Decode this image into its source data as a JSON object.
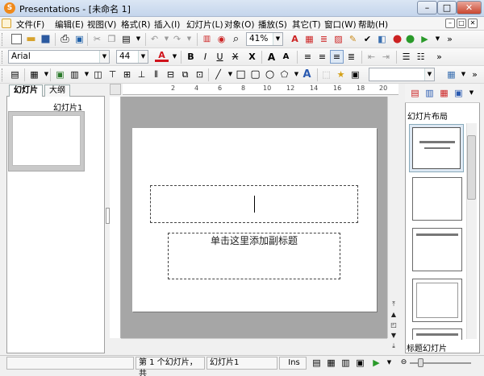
{
  "window": {
    "title": "Presentations - [未命名 1]",
    "app_icon_letter": "S",
    "buttons": [
      "–",
      "□",
      "✕"
    ]
  },
  "menubar": {
    "items": [
      "文件(F)",
      "编辑(E)",
      "视图(V)",
      "格式(R)",
      "插入(I)",
      "幻灯片(L)",
      "对象(O)",
      "播放(S)",
      "其它(T)",
      "窗口(W)",
      "帮助(H)"
    ],
    "doc_controls": [
      "–",
      "□",
      "✕"
    ]
  },
  "toolbar1": {
    "zoom": "41%",
    "overflow": "»"
  },
  "toolbar2": {
    "font_name": "Arial",
    "font_size": "44",
    "font_color_letter": "A",
    "bold": "B",
    "italic": "I",
    "underline": "U",
    "strike": "X",
    "shadow": "X",
    "grow": "A",
    "shrink": "A",
    "overflow": "»"
  },
  "toolbar3": {
    "text_letter": "A",
    "overflow": "»"
  },
  "left_panel": {
    "tabs": [
      "幻灯片",
      "大纲"
    ],
    "slide_label": "幻灯片1"
  },
  "ruler": {
    "ticks": [
      "2",
      "4",
      "6",
      "8",
      "10",
      "12",
      "14",
      "16",
      "18",
      "20"
    ]
  },
  "slide": {
    "subtitle_placeholder": "单击这里添加副标题"
  },
  "task_pane": {
    "title": "幻灯片布局",
    "footer": "标题幻灯片"
  },
  "statusbar": {
    "slide_info": "第 1 个幻灯片，共",
    "slide_name": "幻灯片1",
    "mode": "Ins"
  },
  "colors": {
    "app_icon": "#f08a1c",
    "font_color_red": "#d0121b",
    "workspace_gray": "#a6a6a6"
  }
}
